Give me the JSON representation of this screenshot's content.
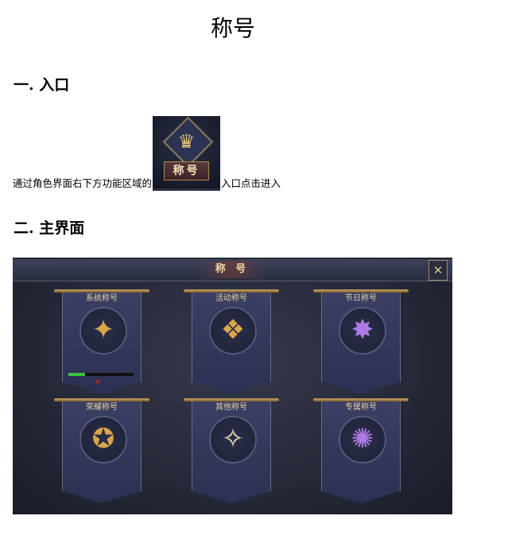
{
  "document": {
    "title": "称号",
    "section1_heading": "一. 入口",
    "section1_text_before": "通过角色界面右下方功能区域的",
    "section1_text_after": "入口点击进入",
    "entry_icon_label": "称号",
    "section2_heading": "二. 主界面"
  },
  "game_ui": {
    "panel_title": "称 号",
    "close_icon": "close-icon",
    "accent_color": "#e6d2a4",
    "cards": [
      {
        "label": "系统称号",
        "icon": "system-title-emblem-icon",
        "color": "gold",
        "glyph": "✦"
      },
      {
        "label": "活动称号",
        "icon": "event-title-emblem-icon",
        "color": "gold",
        "glyph": "❖"
      },
      {
        "label": "节日称号",
        "icon": "festival-title-emblem-icon",
        "color": "purple",
        "glyph": "✸"
      },
      {
        "label": "荣耀称号",
        "icon": "glory-title-emblem-icon",
        "color": "gold",
        "glyph": "✪"
      },
      {
        "label": "其他称号",
        "icon": "other-title-emblem-icon",
        "color": "silver",
        "glyph": "✧"
      },
      {
        "label": "专属称号",
        "icon": "exclusive-title-emblem-icon",
        "color": "purple",
        "glyph": "✺"
      }
    ],
    "system_progress": 0.25,
    "progress_color": "#37c23a"
  }
}
